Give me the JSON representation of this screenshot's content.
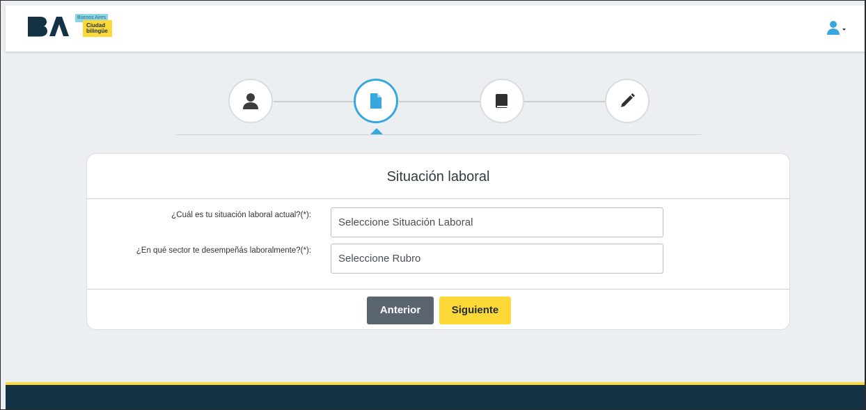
{
  "header": {
    "brand": "BA",
    "city_badge_top": "Buenos Aires",
    "city_badge_line1": "Ciudad",
    "city_badge_line2": "bilingüe"
  },
  "stepper": {
    "steps": [
      {
        "icon": "user-icon",
        "state": "completed"
      },
      {
        "icon": "document-icon",
        "state": "active"
      },
      {
        "icon": "book-icon",
        "state": "pending"
      },
      {
        "icon": "pencil-icon",
        "state": "pending"
      }
    ]
  },
  "form": {
    "title": "Situación laboral",
    "fields": [
      {
        "label": "¿Cuál es tu situación laboral actual?(*):",
        "placeholder": "Seleccione Situación Laboral"
      },
      {
        "label": "¿En qué sector te desempeñás laboralmente?(*):",
        "placeholder": "Seleccione Rubro"
      }
    ],
    "prev_label": "Anterior",
    "next_label": "Siguiente"
  },
  "colors": {
    "accent": "#38a7dd",
    "primary_button": "#fdd836",
    "secondary_button": "#5a6570",
    "footer": "#153144",
    "background": "#ebeff2"
  }
}
